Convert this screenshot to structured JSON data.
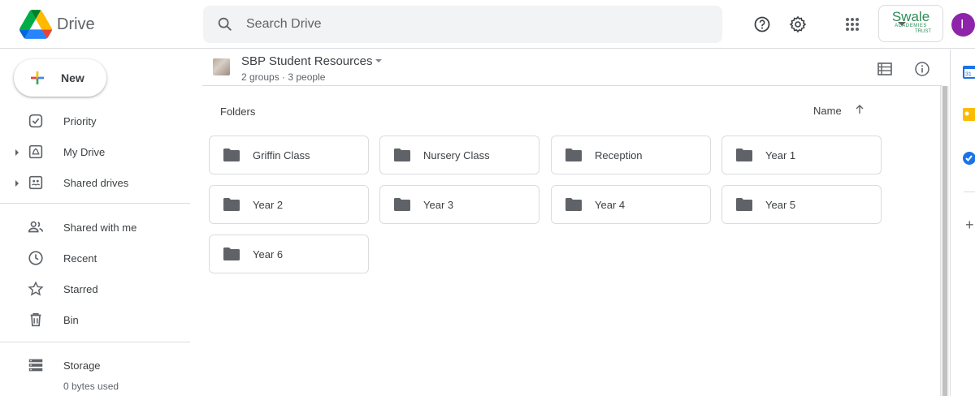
{
  "app": {
    "name": "Drive",
    "colors": {
      "accent": "#1a73e8",
      "avatar_bg": "#8e24aa",
      "org_green": "#2e8b57"
    }
  },
  "header": {
    "search_placeholder": "Search Drive",
    "icons": [
      "help-icon",
      "settings-icon",
      "apps-grid-icon"
    ],
    "org_logo": {
      "name": "Swale",
      "line2": "ACADEMIES",
      "line3": "TRUST"
    },
    "avatar_letter": "I"
  },
  "sidebar": {
    "new_label": "New",
    "items": [
      {
        "label": "Priority",
        "icon": "priority-icon"
      },
      {
        "label": "My Drive",
        "icon": "my-drive-icon"
      },
      {
        "label": "Shared drives",
        "icon": "shared-drives-icon"
      },
      {
        "label": "Shared with me",
        "icon": "shared-with-me-icon"
      },
      {
        "label": "Recent",
        "icon": "clock-icon"
      },
      {
        "label": "Starred",
        "icon": "star-icon"
      },
      {
        "label": "Bin",
        "icon": "bin-icon"
      }
    ],
    "storage": {
      "label": "Storage",
      "used": "0 bytes used"
    }
  },
  "main": {
    "breadcrumb": {
      "title": "SBP Student Resources",
      "subtitle": "2 groups · 3 people"
    },
    "section_label": "Folders",
    "sort": {
      "label": "Name",
      "direction": "ascending"
    },
    "folders": [
      {
        "name": "Griffin Class"
      },
      {
        "name": "Nursery Class"
      },
      {
        "name": "Reception"
      },
      {
        "name": "Year 1"
      },
      {
        "name": "Year 2"
      },
      {
        "name": "Year 3"
      },
      {
        "name": "Year 4"
      },
      {
        "name": "Year 5"
      },
      {
        "name": "Year 6"
      }
    ]
  },
  "side_panel": {
    "icons": [
      "calendar-icon",
      "keep-icon",
      "tasks-icon",
      "add-icon"
    ],
    "calendar_text": "31"
  }
}
